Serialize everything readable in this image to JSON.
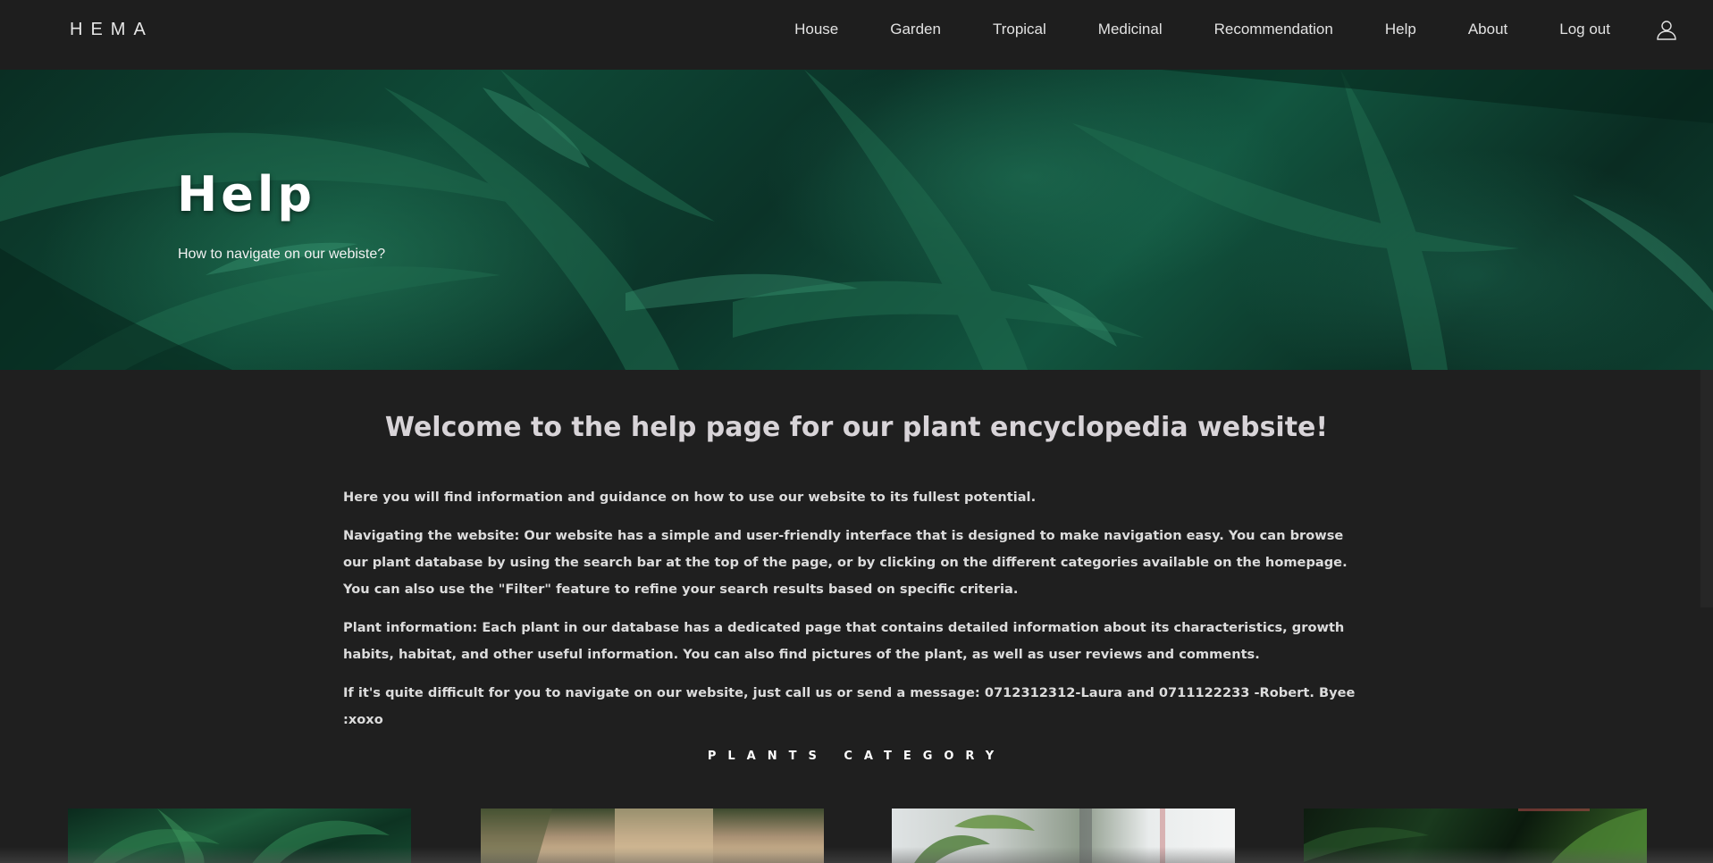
{
  "brand": "HEMA",
  "nav": {
    "links": [
      "House",
      "Garden",
      "Tropical",
      "Medicinal",
      "Recommendation",
      "Help",
      "About",
      "Log out"
    ]
  },
  "hero": {
    "title": "Help",
    "subtitle": "How to navigate on our webiste?"
  },
  "main": {
    "welcome": "Welcome to the help page for our plant encyclopedia website!",
    "paragraphs": [
      "Here you will find information and guidance on how to use our website to its fullest potential.",
      "Navigating the website: Our website has a simple and user-friendly interface that is designed to make navigation easy. You can browse our plant database by using the search bar at the top of the page, or by clicking on the different categories available on the homepage. You can also use the \"Filter\" feature to refine your search results based on specific criteria.",
      "Plant information: Each plant in our database has a dedicated page that contains detailed information about its characteristics, growth habits, habitat, and other useful information. You can also find pictures of the plant, as well as user reviews and comments.",
      "If it's quite difficult for you to navigate on our website, just call us or send a message: 0712312312-Laura and 0711122233 -Robert. Byee :xoxo"
    ],
    "category_title": "PLANTS CATEGORY"
  },
  "colors": {
    "background": "#1f1f1f",
    "navbar": "#1e1e1e",
    "heading": "#d8d4d8",
    "hero_green": "#0f4a37"
  },
  "icons": {
    "user": "user-icon"
  }
}
